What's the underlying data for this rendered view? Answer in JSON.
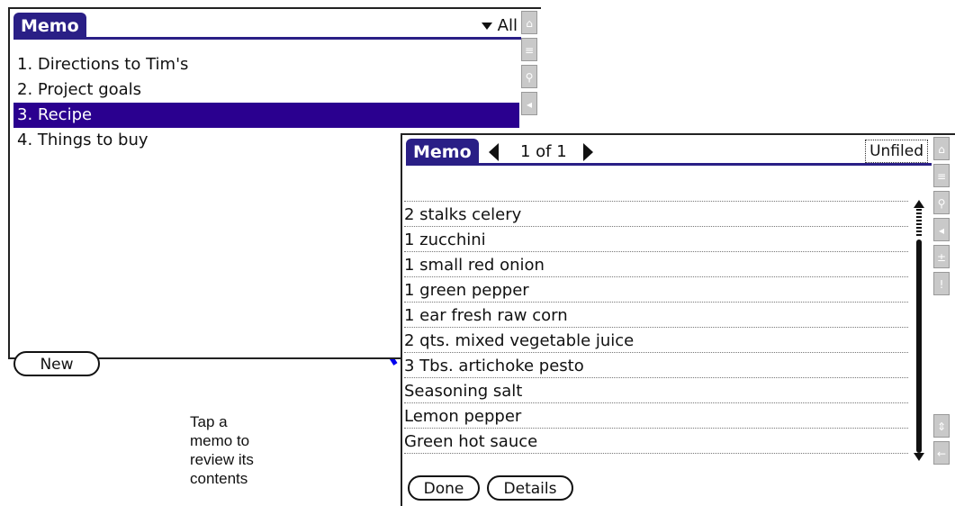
{
  "colors": {
    "title_tab": "#2a1f86",
    "selection": "#2a008f",
    "connector": "#0000ee"
  },
  "list_screen": {
    "title": "Memo",
    "category": "All",
    "memos": [
      {
        "label": "1. Directions to Tim's"
      },
      {
        "label": "2. Project goals"
      },
      {
        "label": "3. Recipe",
        "selected": true
      },
      {
        "label": "4. Things to buy"
      }
    ],
    "new_button": "New",
    "side_icons": [
      "home-icon",
      "menu-icon",
      "find-icon",
      "volume-icon"
    ]
  },
  "detail_screen": {
    "title": "Memo",
    "page_indicator": "1 of 1",
    "category": "Unfiled",
    "lines": [
      "",
      "2 stalks celery",
      "1 zucchini",
      "1 small red onion",
      "1 green pepper",
      "1 ear fresh raw corn",
      "2 qts. mixed vegetable juice",
      "3 Tbs. artichoke pesto",
      "Seasoning salt",
      "Lemon pepper",
      "Green hot sauce"
    ],
    "done_button": "Done",
    "details_button": "Details",
    "side_icons": [
      "home-icon",
      "menu-icon",
      "find-icon",
      "volume-icon",
      "calc-icon",
      "alert-icon",
      "scroll-icon",
      "back-icon"
    ]
  },
  "caption": [
    "Tap a",
    "memo to",
    "review its",
    "contents"
  ]
}
